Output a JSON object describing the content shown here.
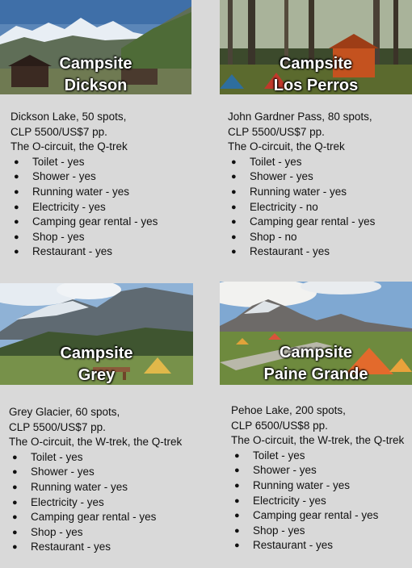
{
  "campsites": [
    {
      "title_line1": "Campsite",
      "title_line2": "Dickson",
      "location": "Dickson Lake, 50 spots,",
      "price": "CLP 5500/US$7 pp.",
      "routes": "The O-circuit, the Q-trek",
      "amenities": [
        "Toilet - yes",
        "Shower - yes",
        "Running water - yes",
        "Electricity - yes",
        "Camping gear rental - yes",
        "Shop - yes",
        "Restaurant - yes"
      ]
    },
    {
      "title_line1": "Campsite",
      "title_line2": "Los Perros",
      "location": "John Gardner Pass, 80 spots,",
      "price": "CLP 5500/US$7 pp.",
      "routes": "The O-circuit, the Q-trek",
      "amenities": [
        "Toilet - yes",
        "Shower - yes",
        "Running water - yes",
        "Electricity - no",
        "Camping gear rental - yes",
        "Shop - no",
        "Restaurant - yes"
      ]
    },
    {
      "title_line1": "Campsite",
      "title_line2": "Grey",
      "location": "Grey Glacier, 60 spots,",
      "price": "CLP 5500/US$7 pp.",
      "routes": "The O-circuit, the W-trek, the Q-trek",
      "amenities": [
        "Toilet - yes",
        "Shower - yes",
        "Running water - yes",
        "Electricity - yes",
        "Camping gear rental - yes",
        "Shop - yes",
        "Restaurant - yes"
      ]
    },
    {
      "title_line1": "Campsite",
      "title_line2": "Paine Grande",
      "location": "Pehoe Lake, 200 spots,",
      "price": "CLP 6500/US$8 pp.",
      "routes": "The O-circuit, the W-trek, the Q-trek",
      "amenities": [
        "Toilet - yes",
        "Shower - yes",
        "Running water - yes",
        "Electricity - yes",
        "Camping gear rental - yes",
        "Shop - yes",
        "Restaurant - yes"
      ]
    }
  ]
}
